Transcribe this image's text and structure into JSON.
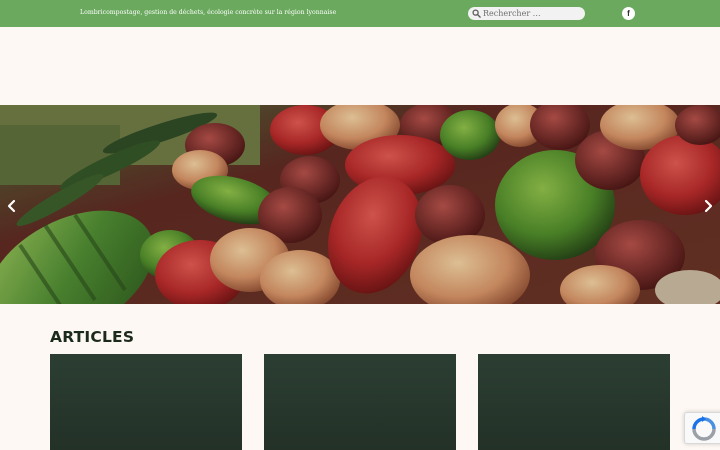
{
  "topbar": {
    "tagline": "Lombricompostage, gestion de déchets, écologie concrète sur la région lyonnaise",
    "search_placeholder": "Rechercher …",
    "facebook_glyph": "f"
  },
  "articles": {
    "title": "ARTICLES"
  },
  "colors": {
    "topbar_green": "#6aa95e",
    "page_background": "#fdf8f3",
    "card_dark_green": "#2c3e33",
    "title_text": "#1c2a1c"
  },
  "icons": {
    "search": "search-icon",
    "facebook": "facebook-icon",
    "slider_prev": "chevron-left-icon",
    "slider_next": "chevron-right-icon",
    "recaptcha": "recaptcha-icon"
  }
}
